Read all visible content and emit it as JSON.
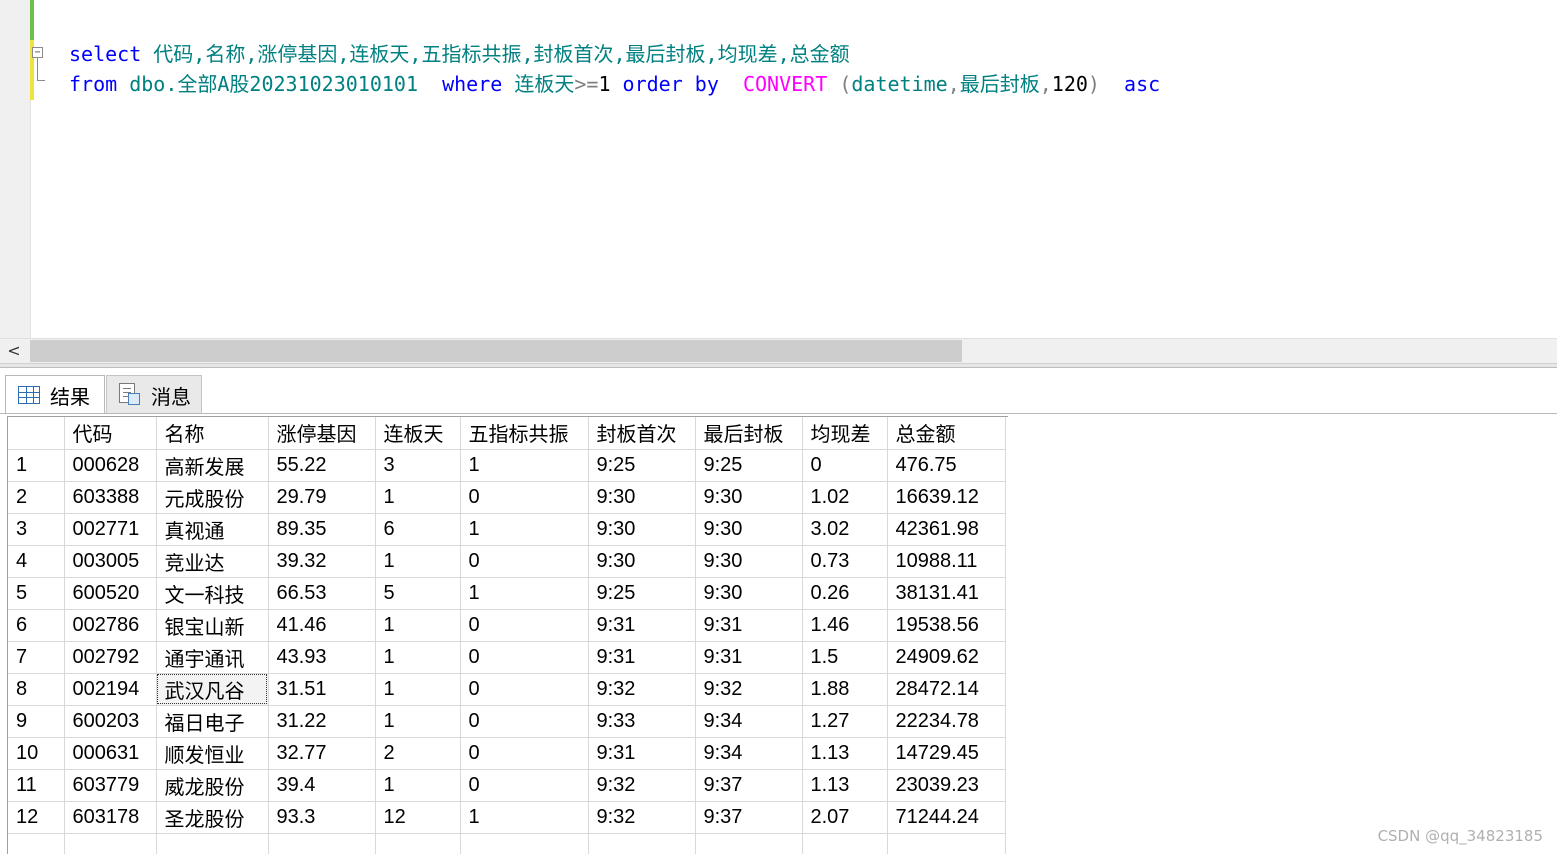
{
  "editor": {
    "line1": {
      "kw_select": "select",
      "columns": "代码,名称,涨停基因,连板天,五指标共振,封板首次,最后封板,均现差,总金额"
    },
    "line2": {
      "kw_from": "from",
      "table_name": "dbo.全部A股20231023010101",
      "kw_where": "where",
      "cond_col": "连板天",
      "cond_op": ">=",
      "cond_val": "1",
      "kw_order_by": "order by",
      "fn_convert": "CONVERT",
      "paren_open": "(",
      "convert_type": "datetime",
      "comma1": ",",
      "convert_col": "最后封板",
      "comma2": ",",
      "style_num": "120",
      "paren_close": ")",
      "kw_asc": "asc"
    },
    "fold_symbol": "−"
  },
  "scrollbar": {
    "left_arrow": "<"
  },
  "tabs": [
    {
      "label": "结果",
      "icon": "grid-icon",
      "active": true
    },
    {
      "label": "消息",
      "icon": "messages-icon",
      "active": false
    }
  ],
  "results": {
    "columns": [
      "",
      "代码",
      "名称",
      "涨停基因",
      "连板天",
      "五指标共振",
      "封板首次",
      "最后封板",
      "均现差",
      "总金额"
    ],
    "rows": [
      [
        "1",
        "000628",
        "高新发展",
        "55.22",
        "3",
        "1",
        "9:25",
        "9:25",
        "0",
        "476.75"
      ],
      [
        "2",
        "603388",
        "元成股份",
        "29.79",
        "1",
        "0",
        "9:30",
        "9:30",
        "1.02",
        "16639.12"
      ],
      [
        "3",
        "002771",
        "真视通",
        "89.35",
        "6",
        "1",
        "9:30",
        "9:30",
        "3.02",
        "42361.98"
      ],
      [
        "4",
        "003005",
        "竞业达",
        "39.32",
        "1",
        "0",
        "9:30",
        "9:30",
        "0.73",
        "10988.11"
      ],
      [
        "5",
        "600520",
        "文一科技",
        "66.53",
        "5",
        "1",
        "9:25",
        "9:30",
        "0.26",
        "38131.41"
      ],
      [
        "6",
        "002786",
        "银宝山新",
        "41.46",
        "1",
        "0",
        "9:31",
        "9:31",
        "1.46",
        "19538.56"
      ],
      [
        "7",
        "002792",
        "通宇通讯",
        "43.93",
        "1",
        "0",
        "9:31",
        "9:31",
        "1.5",
        "24909.62"
      ],
      [
        "8",
        "002194",
        "武汉凡谷",
        "31.51",
        "1",
        "0",
        "9:32",
        "9:32",
        "1.88",
        "28472.14"
      ],
      [
        "9",
        "600203",
        "福日电子",
        "31.22",
        "1",
        "0",
        "9:33",
        "9:34",
        "1.27",
        "22234.78"
      ],
      [
        "10",
        "000631",
        "顺发恒业",
        "32.77",
        "2",
        "0",
        "9:31",
        "9:34",
        "1.13",
        "14729.45"
      ],
      [
        "11",
        "603779",
        "威龙股份",
        "39.4",
        "1",
        "0",
        "9:32",
        "9:37",
        "1.13",
        "23039.23"
      ],
      [
        "12",
        "603178",
        "圣龙股份",
        "93.3",
        "12",
        "1",
        "9:32",
        "9:37",
        "2.07",
        "71244.24"
      ]
    ],
    "selected_cell": {
      "row": 8,
      "column": "名称"
    }
  },
  "watermark": "CSDN @qq_34823185",
  "colors": {
    "keyword": "#0000ff",
    "identifier": "#008080",
    "operator": "#808080",
    "function": "#ff00ff"
  }
}
